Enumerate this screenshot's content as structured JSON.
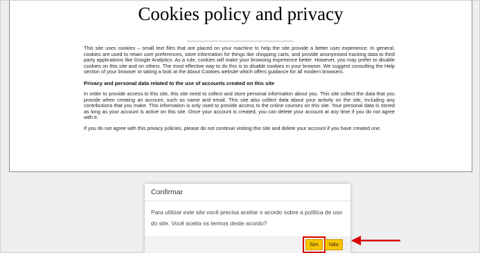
{
  "document": {
    "title": "Cookies policy and privacy",
    "paragraphs": [
      "This site uses cookies – small text files that are placed on your machine to help the site provide a better user experience. In general, cookies are used to retain user preferences, store information for things like shopping carts, and provide anonymised tracking data to third party applications like Google Analytics. As a rule, cookies will make your browsing experience better. However, you may prefer to disable cookies on this site and on others. The most effective way to do this is to disable cookies in your browser. We suggest consulting the Help section of your browser or taking a look at the About Cookies website which offers guidance for all modern browsers.",
      "In order to provide access to this site, this site need to collect and store personal information about you. This site collect the data that you provide when creating an account, such as name and email. This site also collect data about your activity on the site, including any contributions that you make. This information is only used to provide access to the online courses on this site. Your personal data is stored as long as your account is active on this site. Once your account is created, you can delete your account at any time if you do not agree with it.",
      "If you do not agree with this privacy policies, please do not continue visiting this site and delete your account if you have created one."
    ],
    "section_heading": "Privacy and personal data related to the use of accounts created on this site"
  },
  "modal": {
    "title": "Confirmar",
    "message": "Para utilizar este site você precisa aceitar o acordo sobre a política de uso do site. Você aceita os termos deste acordo?",
    "buttons": {
      "yes": "Sim",
      "no": "Não"
    }
  },
  "annotation": {
    "highlight_color": "#d90000",
    "arrow_icon": "arrow-left-icon"
  },
  "colors": {
    "button_bg": "#f7c400"
  }
}
